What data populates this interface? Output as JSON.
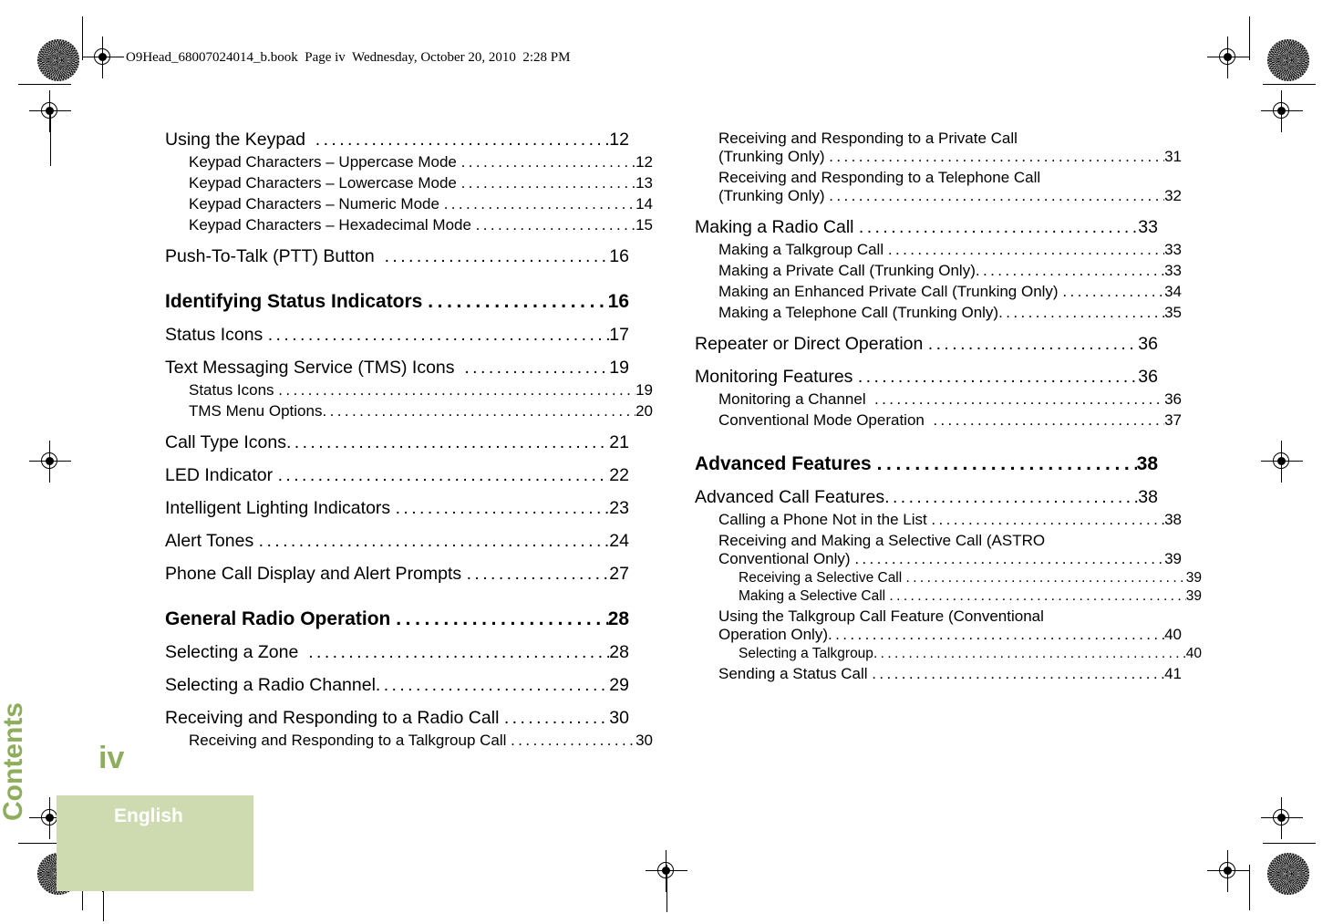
{
  "header": {
    "text": "O9Head_68007024014_b.book  Page iv  Wednesday, October 20, 2010  2:28 PM"
  },
  "sidebar": {
    "tab_label": "Contents",
    "folio": "iv",
    "language": "English",
    "tab_color": "#8fae5d",
    "block_color": "#cedbb0"
  },
  "toc": {
    "left_column": [
      {
        "level": 1,
        "label": "Using the Keypad  ",
        "page": "12"
      },
      {
        "level": 2,
        "label": "Keypad Characters – Uppercase Mode ",
        "page": "12"
      },
      {
        "level": 2,
        "label": "Keypad Characters – Lowercase Mode ",
        "page": "13"
      },
      {
        "level": 2,
        "label": "Keypad Characters – Numeric Mode ",
        "page": "14"
      },
      {
        "level": 2,
        "label": "Keypad Characters – Hexadecimal Mode ",
        "page": "15"
      },
      {
        "level": 1,
        "label": "Push-To-Talk (PTT) Button  ",
        "page": "16"
      },
      {
        "level": 0,
        "label": "Identifying Status Indicators ",
        "page": "16"
      },
      {
        "level": 1,
        "label": "Status Icons ",
        "page": "17"
      },
      {
        "level": 1,
        "label": "Text Messaging Service (TMS) Icons  ",
        "page": "19"
      },
      {
        "level": 2,
        "label": "Status Icons ",
        "page": "19"
      },
      {
        "level": 2,
        "label": "TMS Menu Options",
        "page": "20"
      },
      {
        "level": 1,
        "label": "Call Type Icons",
        "page": "21"
      },
      {
        "level": 1,
        "label": "LED Indicator ",
        "page": "22"
      },
      {
        "level": 1,
        "label": "Intelligent Lighting Indicators ",
        "page": "23"
      },
      {
        "level": 1,
        "label": "Alert Tones ",
        "page": "24"
      },
      {
        "level": 1,
        "label": "Phone Call Display and Alert Prompts ",
        "page": "27"
      },
      {
        "level": 0,
        "label": "General Radio Operation ",
        "page": "28"
      },
      {
        "level": 1,
        "label": "Selecting a Zone  ",
        "page": "28"
      },
      {
        "level": 1,
        "label": "Selecting a Radio Channel",
        "page": "29"
      },
      {
        "level": 1,
        "label": "Receiving and Responding to a Radio Call ",
        "page": "30"
      },
      {
        "level": 2,
        "label": "Receiving and Responding to a Talkgroup Call ",
        "page": "30"
      }
    ],
    "right_column": [
      {
        "level": 2,
        "wrapped": true,
        "line1": "Receiving and Responding to a Private Call",
        "label": "(Trunking Only) ",
        "page": "31"
      },
      {
        "level": 2,
        "wrapped": true,
        "line1": "Receiving and Responding to a Telephone Call",
        "label": "(Trunking Only) ",
        "page": "32"
      },
      {
        "level": 1,
        "label": "Making a Radio Call ",
        "page": "33"
      },
      {
        "level": 2,
        "label": "Making a Talkgroup Call ",
        "page": "33"
      },
      {
        "level": 2,
        "label": "Making a Private Call (Trunking Only)",
        "page": "33"
      },
      {
        "level": 2,
        "label": "Making an Enhanced Private Call (Trunking Only) ",
        "page": "34"
      },
      {
        "level": 2,
        "label": "Making a Telephone Call (Trunking Only)",
        "page": "35"
      },
      {
        "level": 1,
        "label": "Repeater or Direct Operation ",
        "page": "36"
      },
      {
        "level": 1,
        "label": "Monitoring Features ",
        "page": "36"
      },
      {
        "level": 2,
        "label": "Monitoring a Channel  ",
        "page": "36"
      },
      {
        "level": 2,
        "label": "Conventional Mode Operation  ",
        "page": "37"
      },
      {
        "level": 0,
        "label": "Advanced Features ",
        "page": "38"
      },
      {
        "level": 1,
        "label": "Advanced Call Features",
        "page": "38"
      },
      {
        "level": 2,
        "label": "Calling a Phone Not in the List ",
        "page": "38"
      },
      {
        "level": 2,
        "wrapped": true,
        "line1": "Receiving and Making a Selective Call (ASTRO",
        "label": "Conventional Only) ",
        "page": "39"
      },
      {
        "level": 3,
        "label": "Receiving a Selective Call ",
        "page": "39"
      },
      {
        "level": 3,
        "label": "Making a Selective Call ",
        "page": "39"
      },
      {
        "level": 2,
        "wrapped": true,
        "line1": "Using the Talkgroup Call Feature (Conventional",
        "label": "Operation Only)",
        "page": "40"
      },
      {
        "level": 3,
        "label": "Selecting a Talkgroup",
        "page": "40"
      },
      {
        "level": 2,
        "label": "Sending a Status Call ",
        "page": "41"
      }
    ]
  }
}
